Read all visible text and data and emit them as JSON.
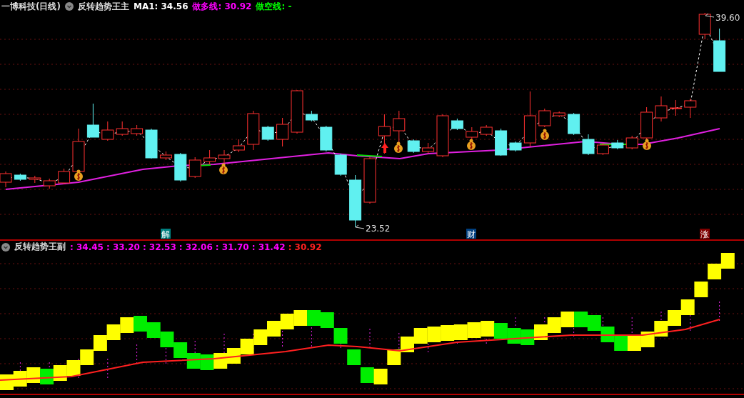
{
  "main_panel": {
    "stock": "一博科技(日线)",
    "indicator": "反转趋势王主",
    "readings": [
      {
        "text": "MA1: 34.56",
        "color": "#ffffff"
      },
      {
        "text": "做多线: 30.92",
        "color": "#ff00ff"
      },
      {
        "text": "做空线: -",
        "color": "#00ff00"
      }
    ],
    "high_label": "39.60",
    "low_label": "23.52",
    "markers": [
      {
        "text": "解",
        "color": "#007f7f"
      },
      {
        "text": "财",
        "color": "#003f7f"
      },
      {
        "text": "涨",
        "color": "#7f0000"
      }
    ]
  },
  "sub_panel": {
    "indicator": "反转趋势王副",
    "readings": [
      {
        "text": ": 34.45",
        "color": "#ff00ff"
      },
      {
        "text": ": 33.20",
        "color": "#ff00ff"
      },
      {
        "text": ": 32.53",
        "color": "#ff00ff"
      },
      {
        "text": ": 32.06",
        "color": "#ff00ff"
      },
      {
        "text": ": 31.70",
        "color": "#ff00ff"
      },
      {
        "text": ": 31.42",
        "color": "#ff00ff"
      },
      {
        "text": ": 30.92",
        "color": "#ff2020"
      }
    ]
  }
}
